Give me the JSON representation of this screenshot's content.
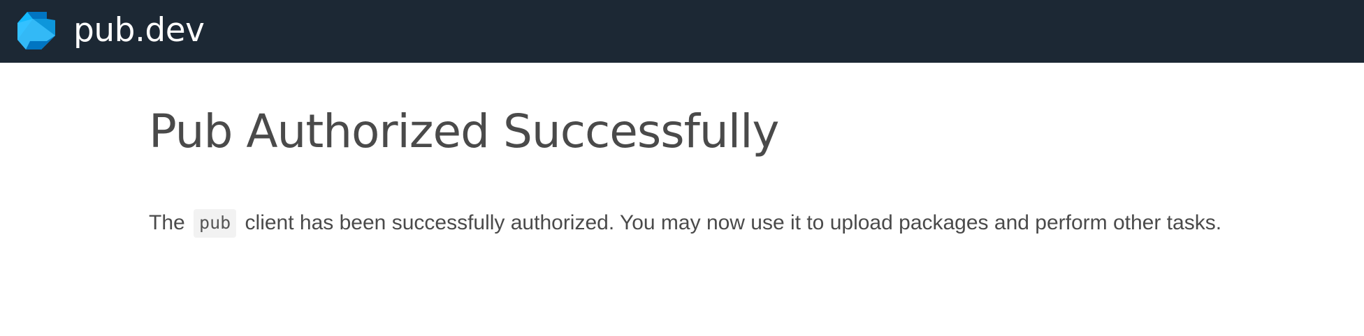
{
  "header": {
    "logo_text": "pub.dev",
    "logo_icon": "dart-logo-icon",
    "background_color": "#1c2834"
  },
  "main": {
    "title": "Pub Authorized Successfully",
    "message": {
      "before": "The",
      "code": "pub",
      "after": "client has been successfully authorized. You may now use it to upload packages and perform other tasks."
    }
  }
}
